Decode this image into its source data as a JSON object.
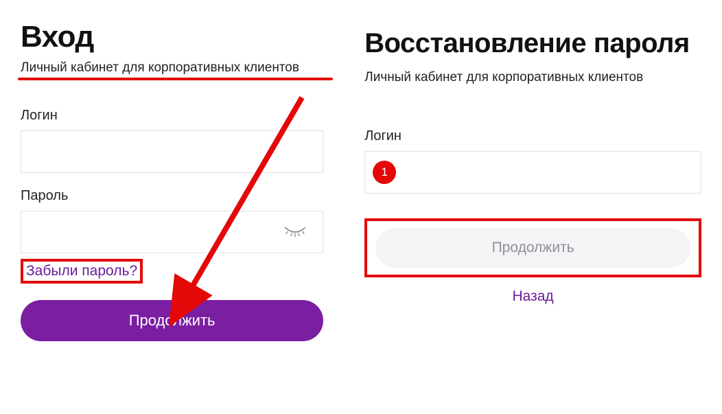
{
  "login": {
    "title": "Вход",
    "subtitle": "Личный кабинет для корпоративных клиентов",
    "login_label": "Логин",
    "login_value": "",
    "password_label": "Пароль",
    "password_value": "",
    "forgot_link_text": "Забыли пароль?",
    "continue_button": "Продолжить"
  },
  "recovery": {
    "title": "Восстановление пароля",
    "subtitle": "Личный кабинет для корпоративных клиентов",
    "login_label": "Логин",
    "login_value": "",
    "badge_text": "1",
    "continue_button": "Продолжить",
    "back_link_text": "Назад"
  },
  "colors": {
    "accent_purple": "#7b1fa2",
    "annotation_red": "#e40808",
    "text_dark": "#111",
    "muted": "#8f8f96"
  }
}
